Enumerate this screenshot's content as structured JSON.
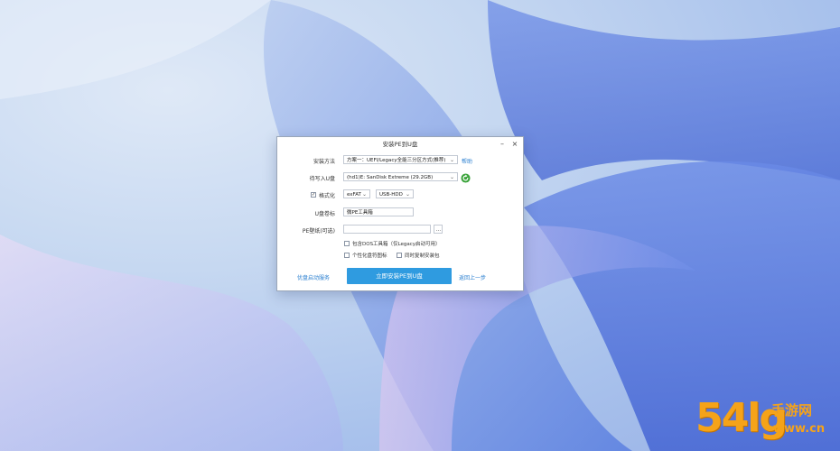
{
  "dialog": {
    "title": "安装PE到U盘",
    "minimize": "–",
    "close": "×",
    "rows": {
      "scheme": {
        "label": "安装方法",
        "value": "方案一：UEFI/Legacy全能三分区方式(推荐)",
        "help": "帮助"
      },
      "drive": {
        "label": "待写入U盘",
        "value": "(hd1)E: SanDisk Extreme (29.2GB)"
      },
      "format": {
        "label": "格式化",
        "checked": true,
        "fs": "exFAT",
        "mode": "USB-HDD"
      },
      "volume": {
        "label": "U盘卷标",
        "value": "微PE工具箱"
      },
      "wallpaper": {
        "label": "PE壁纸(可选)",
        "value": "",
        "browse": "..."
      }
    },
    "options": [
      {
        "label": "包含DOS工具箱（仅Legacy启动可用）",
        "checked": false
      },
      {
        "label": "个性化盘符图标",
        "checked": false
      },
      {
        "label": "同时复制安装包",
        "checked": false
      }
    ],
    "footer": {
      "left_link": "优盘启动服务",
      "primary": "立即安装PE到U盘",
      "right_link": "返回上一步"
    }
  },
  "watermark": {
    "number": "54",
    "glyph": "lg",
    "brand": "手游网",
    "url": "www.cn"
  },
  "colors": {
    "accent": "#2f9be0",
    "link": "#2a7fd0",
    "watermark": "#f5a319",
    "refresh": "#3aa33a"
  }
}
